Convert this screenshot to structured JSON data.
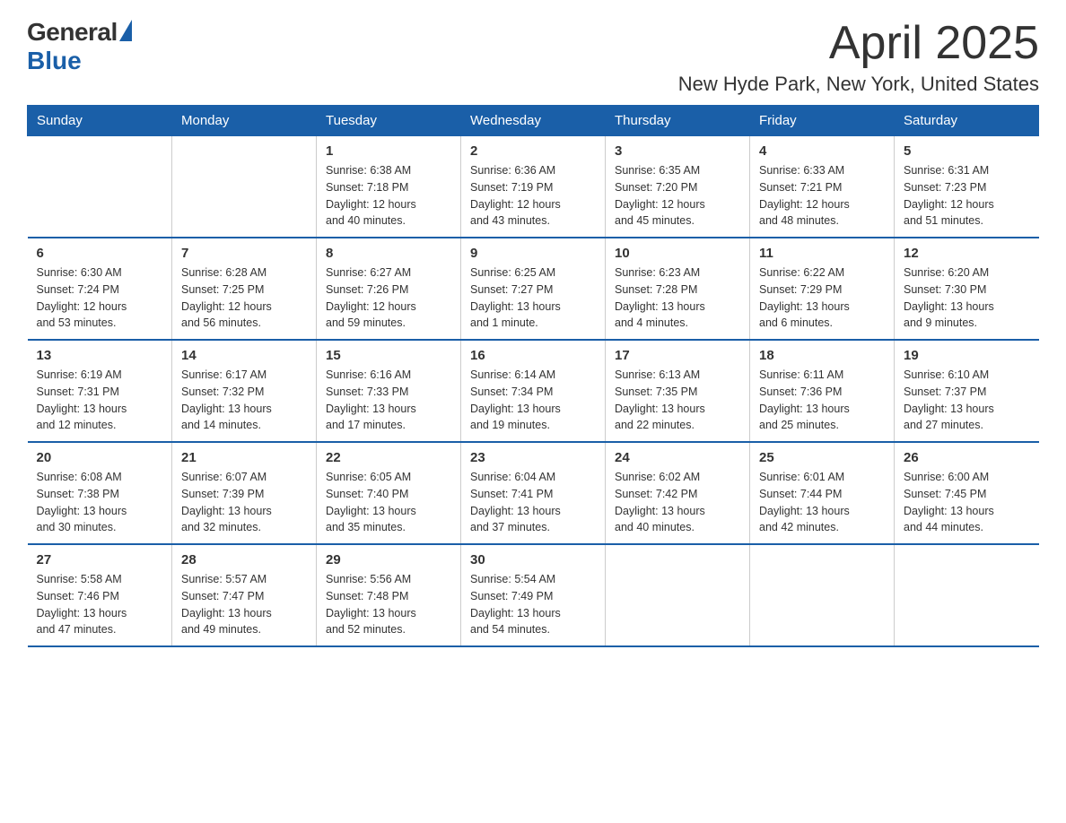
{
  "logo": {
    "general": "General",
    "blue": "Blue"
  },
  "header": {
    "month": "April 2025",
    "location": "New Hyde Park, New York, United States"
  },
  "weekdays": [
    "Sunday",
    "Monday",
    "Tuesday",
    "Wednesday",
    "Thursday",
    "Friday",
    "Saturday"
  ],
  "weeks": [
    [
      {
        "day": "",
        "info": ""
      },
      {
        "day": "",
        "info": ""
      },
      {
        "day": "1",
        "info": "Sunrise: 6:38 AM\nSunset: 7:18 PM\nDaylight: 12 hours\nand 40 minutes."
      },
      {
        "day": "2",
        "info": "Sunrise: 6:36 AM\nSunset: 7:19 PM\nDaylight: 12 hours\nand 43 minutes."
      },
      {
        "day": "3",
        "info": "Sunrise: 6:35 AM\nSunset: 7:20 PM\nDaylight: 12 hours\nand 45 minutes."
      },
      {
        "day": "4",
        "info": "Sunrise: 6:33 AM\nSunset: 7:21 PM\nDaylight: 12 hours\nand 48 minutes."
      },
      {
        "day": "5",
        "info": "Sunrise: 6:31 AM\nSunset: 7:23 PM\nDaylight: 12 hours\nand 51 minutes."
      }
    ],
    [
      {
        "day": "6",
        "info": "Sunrise: 6:30 AM\nSunset: 7:24 PM\nDaylight: 12 hours\nand 53 minutes."
      },
      {
        "day": "7",
        "info": "Sunrise: 6:28 AM\nSunset: 7:25 PM\nDaylight: 12 hours\nand 56 minutes."
      },
      {
        "day": "8",
        "info": "Sunrise: 6:27 AM\nSunset: 7:26 PM\nDaylight: 12 hours\nand 59 minutes."
      },
      {
        "day": "9",
        "info": "Sunrise: 6:25 AM\nSunset: 7:27 PM\nDaylight: 13 hours\nand 1 minute."
      },
      {
        "day": "10",
        "info": "Sunrise: 6:23 AM\nSunset: 7:28 PM\nDaylight: 13 hours\nand 4 minutes."
      },
      {
        "day": "11",
        "info": "Sunrise: 6:22 AM\nSunset: 7:29 PM\nDaylight: 13 hours\nand 6 minutes."
      },
      {
        "day": "12",
        "info": "Sunrise: 6:20 AM\nSunset: 7:30 PM\nDaylight: 13 hours\nand 9 minutes."
      }
    ],
    [
      {
        "day": "13",
        "info": "Sunrise: 6:19 AM\nSunset: 7:31 PM\nDaylight: 13 hours\nand 12 minutes."
      },
      {
        "day": "14",
        "info": "Sunrise: 6:17 AM\nSunset: 7:32 PM\nDaylight: 13 hours\nand 14 minutes."
      },
      {
        "day": "15",
        "info": "Sunrise: 6:16 AM\nSunset: 7:33 PM\nDaylight: 13 hours\nand 17 minutes."
      },
      {
        "day": "16",
        "info": "Sunrise: 6:14 AM\nSunset: 7:34 PM\nDaylight: 13 hours\nand 19 minutes."
      },
      {
        "day": "17",
        "info": "Sunrise: 6:13 AM\nSunset: 7:35 PM\nDaylight: 13 hours\nand 22 minutes."
      },
      {
        "day": "18",
        "info": "Sunrise: 6:11 AM\nSunset: 7:36 PM\nDaylight: 13 hours\nand 25 minutes."
      },
      {
        "day": "19",
        "info": "Sunrise: 6:10 AM\nSunset: 7:37 PM\nDaylight: 13 hours\nand 27 minutes."
      }
    ],
    [
      {
        "day": "20",
        "info": "Sunrise: 6:08 AM\nSunset: 7:38 PM\nDaylight: 13 hours\nand 30 minutes."
      },
      {
        "day": "21",
        "info": "Sunrise: 6:07 AM\nSunset: 7:39 PM\nDaylight: 13 hours\nand 32 minutes."
      },
      {
        "day": "22",
        "info": "Sunrise: 6:05 AM\nSunset: 7:40 PM\nDaylight: 13 hours\nand 35 minutes."
      },
      {
        "day": "23",
        "info": "Sunrise: 6:04 AM\nSunset: 7:41 PM\nDaylight: 13 hours\nand 37 minutes."
      },
      {
        "day": "24",
        "info": "Sunrise: 6:02 AM\nSunset: 7:42 PM\nDaylight: 13 hours\nand 40 minutes."
      },
      {
        "day": "25",
        "info": "Sunrise: 6:01 AM\nSunset: 7:44 PM\nDaylight: 13 hours\nand 42 minutes."
      },
      {
        "day": "26",
        "info": "Sunrise: 6:00 AM\nSunset: 7:45 PM\nDaylight: 13 hours\nand 44 minutes."
      }
    ],
    [
      {
        "day": "27",
        "info": "Sunrise: 5:58 AM\nSunset: 7:46 PM\nDaylight: 13 hours\nand 47 minutes."
      },
      {
        "day": "28",
        "info": "Sunrise: 5:57 AM\nSunset: 7:47 PM\nDaylight: 13 hours\nand 49 minutes."
      },
      {
        "day": "29",
        "info": "Sunrise: 5:56 AM\nSunset: 7:48 PM\nDaylight: 13 hours\nand 52 minutes."
      },
      {
        "day": "30",
        "info": "Sunrise: 5:54 AM\nSunset: 7:49 PM\nDaylight: 13 hours\nand 54 minutes."
      },
      {
        "day": "",
        "info": ""
      },
      {
        "day": "",
        "info": ""
      },
      {
        "day": "",
        "info": ""
      }
    ]
  ]
}
